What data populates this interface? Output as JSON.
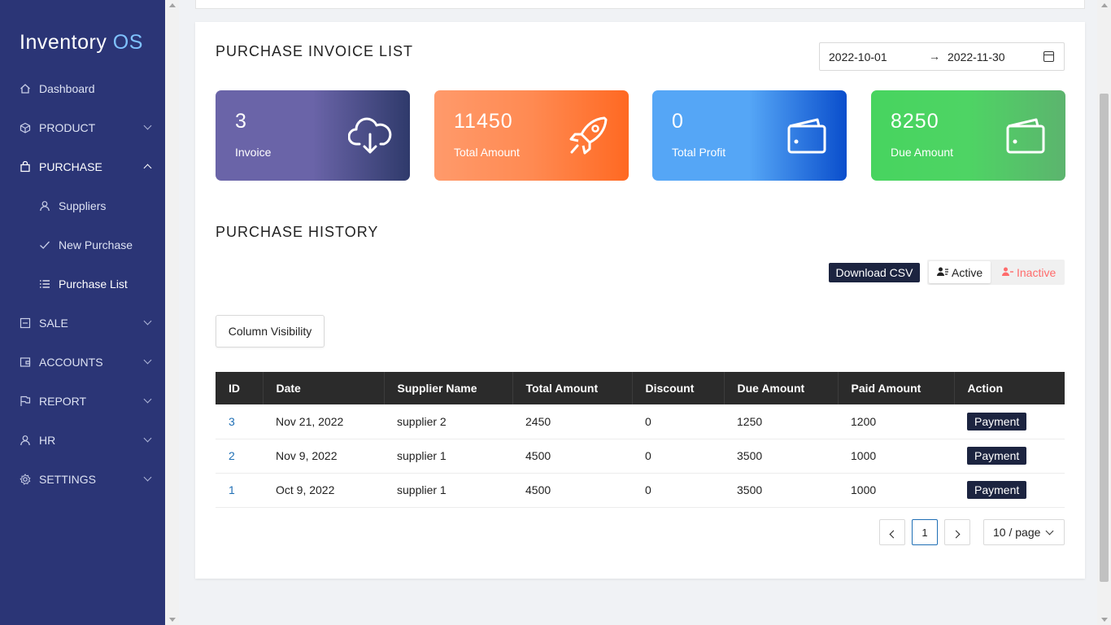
{
  "app": {
    "logo_main": "Inventory",
    "logo_accent": "OS"
  },
  "sidebar": {
    "items": [
      {
        "label": "Dashboard",
        "icon": "home-icon"
      },
      {
        "label": "PRODUCT",
        "icon": "box-icon"
      },
      {
        "label": "PURCHASE",
        "icon": "bag-icon"
      },
      {
        "label": "Suppliers",
        "icon": "user-icon"
      },
      {
        "label": "New Purchase",
        "icon": "check-icon"
      },
      {
        "label": "Purchase List",
        "icon": "list-icon"
      },
      {
        "label": "SALE",
        "icon": "minus-box-icon"
      },
      {
        "label": "ACCOUNTS",
        "icon": "wallet-icon"
      },
      {
        "label": "REPORT",
        "icon": "flag-icon"
      },
      {
        "label": "HR",
        "icon": "user-icon"
      },
      {
        "label": "SETTINGS",
        "icon": "gear-icon"
      }
    ]
  },
  "header": {
    "title": "PURCHASE INVOICE LIST"
  },
  "daterange": {
    "start": "2022-10-01",
    "end": "2022-11-30",
    "separator": "→"
  },
  "stats": [
    {
      "value": "3",
      "label": "Invoice",
      "icon": "cloud-download-icon"
    },
    {
      "value": "11450",
      "label": "Total Amount",
      "icon": "rocket-icon"
    },
    {
      "value": "0",
      "label": "Total Profit",
      "icon": "wallet-icon"
    },
    {
      "value": "8250",
      "label": "Due Amount",
      "icon": "wallet-icon"
    }
  ],
  "history": {
    "title": "PURCHASE HISTORY",
    "download_label": "Download CSV",
    "active_label": "Active",
    "inactive_label": "Inactive",
    "column_visibility_label": "Column Visibility"
  },
  "table": {
    "headers": [
      "ID",
      "Date",
      "Supplier Name",
      "Total Amount",
      "Discount",
      "Due Amount",
      "Paid Amount",
      "Action"
    ],
    "rows": [
      {
        "id": "3",
        "date": "Nov 21, 2022",
        "supplier": "supplier 2",
        "total": "2450",
        "discount": "0",
        "due": "1250",
        "paid": "1200",
        "action": "Payment"
      },
      {
        "id": "2",
        "date": "Nov 9, 2022",
        "supplier": "supplier 1",
        "total": "4500",
        "discount": "0",
        "due": "3500",
        "paid": "1000",
        "action": "Payment"
      },
      {
        "id": "1",
        "date": "Oct 9, 2022",
        "supplier": "supplier 1",
        "total": "4500",
        "discount": "0",
        "due": "3500",
        "paid": "1000",
        "action": "Payment"
      }
    ]
  },
  "pagination": {
    "current": "1",
    "page_size": "10 / page"
  },
  "colors": {
    "sidebar": "#2b3576",
    "dark_button": "#1c2440",
    "link": "#1f6fb5",
    "inactive": "#ff6b6b"
  }
}
